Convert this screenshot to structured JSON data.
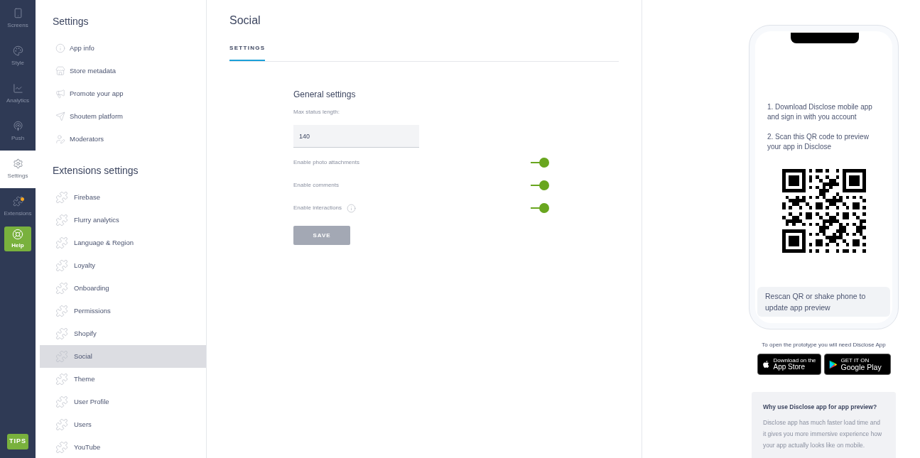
{
  "rail": [
    {
      "label": "Screens",
      "selected": false,
      "badge": false
    },
    {
      "label": "Style",
      "selected": false,
      "badge": false
    },
    {
      "label": "Analytics",
      "selected": false,
      "badge": false
    },
    {
      "label": "Push",
      "selected": false,
      "badge": false
    },
    {
      "label": "Settings",
      "selected": true,
      "badge": false
    },
    {
      "label": "Extensions",
      "selected": false,
      "badge": true
    }
  ],
  "help_button": "Help",
  "tips_button": "TIPS",
  "sidebar": {
    "sections": [
      {
        "title": "Settings",
        "items": [
          {
            "label": "App info",
            "selected": false
          },
          {
            "label": "Store metadata",
            "selected": false
          },
          {
            "label": "Promote your app",
            "selected": false
          },
          {
            "label": "Shoutem platform",
            "selected": false
          },
          {
            "label": "Moderators",
            "selected": false
          }
        ]
      },
      {
        "title": "Extensions settings",
        "items": [
          {
            "label": "Firebase",
            "selected": false
          },
          {
            "label": "Flurry analytics",
            "selected": false
          },
          {
            "label": "Language & Region",
            "selected": false
          },
          {
            "label": "Loyalty",
            "selected": false
          },
          {
            "label": "Onboarding",
            "selected": false
          },
          {
            "label": "Permissions",
            "selected": false
          },
          {
            "label": "Shopify",
            "selected": false
          },
          {
            "label": "Social",
            "selected": true
          },
          {
            "label": "Theme",
            "selected": false
          },
          {
            "label": "User Profile",
            "selected": false
          },
          {
            "label": "Users",
            "selected": false
          },
          {
            "label": "YouTube",
            "selected": false
          }
        ]
      }
    ]
  },
  "main": {
    "title": "Social",
    "tabs": [
      {
        "label": "SETTINGS",
        "selected": true
      }
    ],
    "section_title": "General settings",
    "field": {
      "label": "Max status length:",
      "value": "140"
    },
    "toggles": [
      {
        "label": "Enable photo attachments",
        "on": true,
        "info": false
      },
      {
        "label": "Enable comments",
        "on": true,
        "info": false
      },
      {
        "label": "Enable interactions",
        "on": true,
        "info": true
      }
    ],
    "save_button": {
      "label": "SAVE",
      "disabled": true
    }
  },
  "preview": {
    "steps": [
      "1. Download Disclose mobile app and sign in with you account",
      "2. Scan this QR code to preview your app in Disclose"
    ],
    "rescan_note": "Rescan QR or shake phone to update app preview",
    "store_caption": "To open the prototype you will need Disclose App",
    "app_store": {
      "small": "Download on the",
      "big": "App Store"
    },
    "google_play": {
      "small": "GET IT ON",
      "big": "Google Play"
    },
    "why": {
      "title": "Why use Disclose app for app preview?",
      "text": "Disclose app has much faster load time and it gives you more immersive experience how your app actually looks like on mobile."
    }
  }
}
